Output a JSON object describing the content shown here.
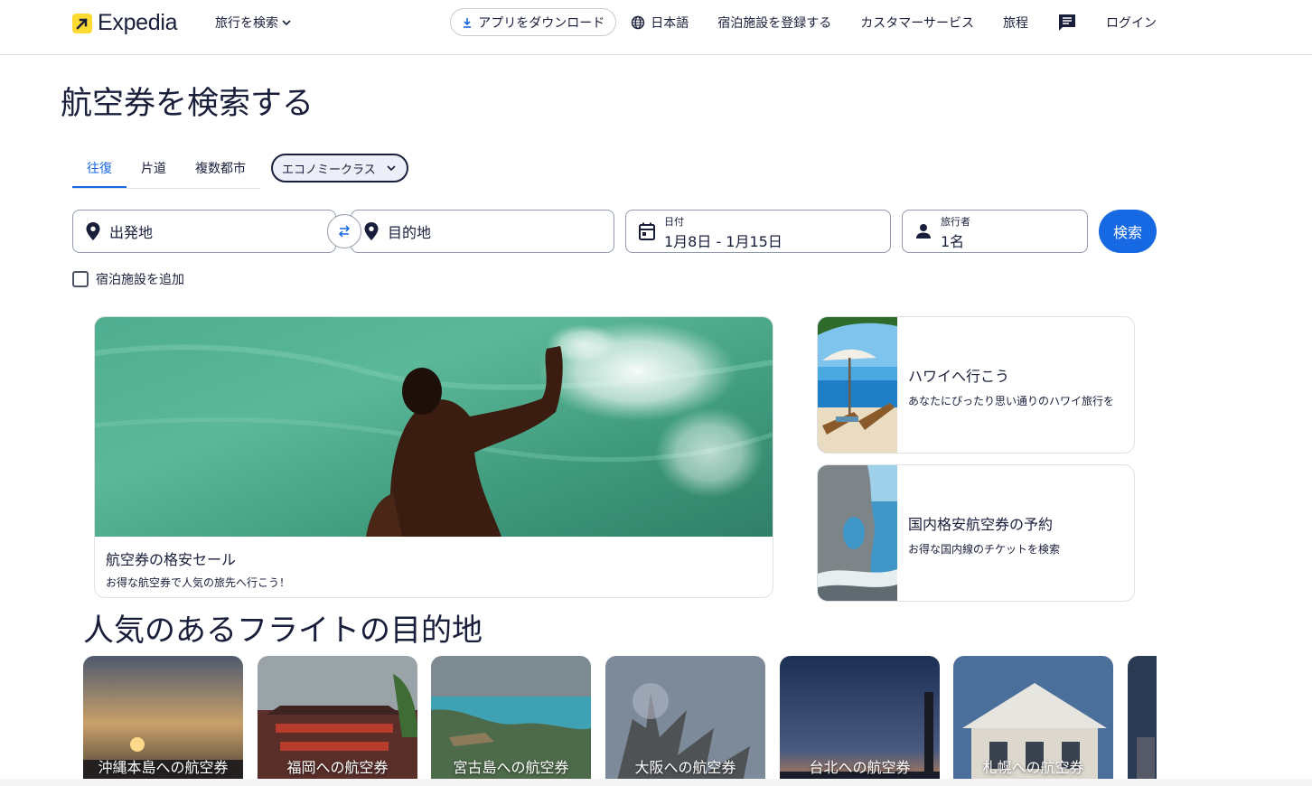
{
  "header": {
    "brand": "Expedia",
    "trip_search": "旅行を検索",
    "app_download": "アプリをダウンロード",
    "language": "日本語",
    "list_property": "宿泊施設を登録する",
    "customer_service": "カスタマーサービス",
    "trips": "旅程",
    "login": "ログイン"
  },
  "page_title": "航空券を検索する",
  "tabs": [
    {
      "label": "往復",
      "active": true
    },
    {
      "label": "片道",
      "active": false
    },
    {
      "label": "複数都市",
      "active": false
    }
  ],
  "cabin_class": "エコノミークラス",
  "search": {
    "origin_placeholder": "出発地",
    "destination_placeholder": "目的地",
    "date_label": "日付",
    "date_value": "1月8日 - 1月15日",
    "travelers_label": "旅行者",
    "travelers_value": "1名",
    "search_button": "検索",
    "add_stay": "宿泊施設を追加"
  },
  "hero": {
    "title": "航空券の格安セール",
    "subtitle": "お得な航空券で人気の旅先へ行こう！"
  },
  "side_cards": [
    {
      "title": "ハワイへ行こう",
      "subtitle": "あなたにぴったり思い通りのハワイ旅行を"
    },
    {
      "title": "国内格安航空券の予約",
      "subtitle": "お得な国内線のチケットを検索"
    }
  ],
  "popular": {
    "title": "人気のあるフライトの目的地",
    "destinations": [
      {
        "label": "沖縄本島への航空券"
      },
      {
        "label": "福岡への航空券"
      },
      {
        "label": "宮古島への航空券"
      },
      {
        "label": "大阪への航空券"
      },
      {
        "label": "台北への航空券"
      },
      {
        "label": "札幌への航空券"
      }
    ]
  },
  "colors": {
    "primary": "#1668e3",
    "brand_yellow": "#fddb32",
    "text": "#191e3b"
  }
}
